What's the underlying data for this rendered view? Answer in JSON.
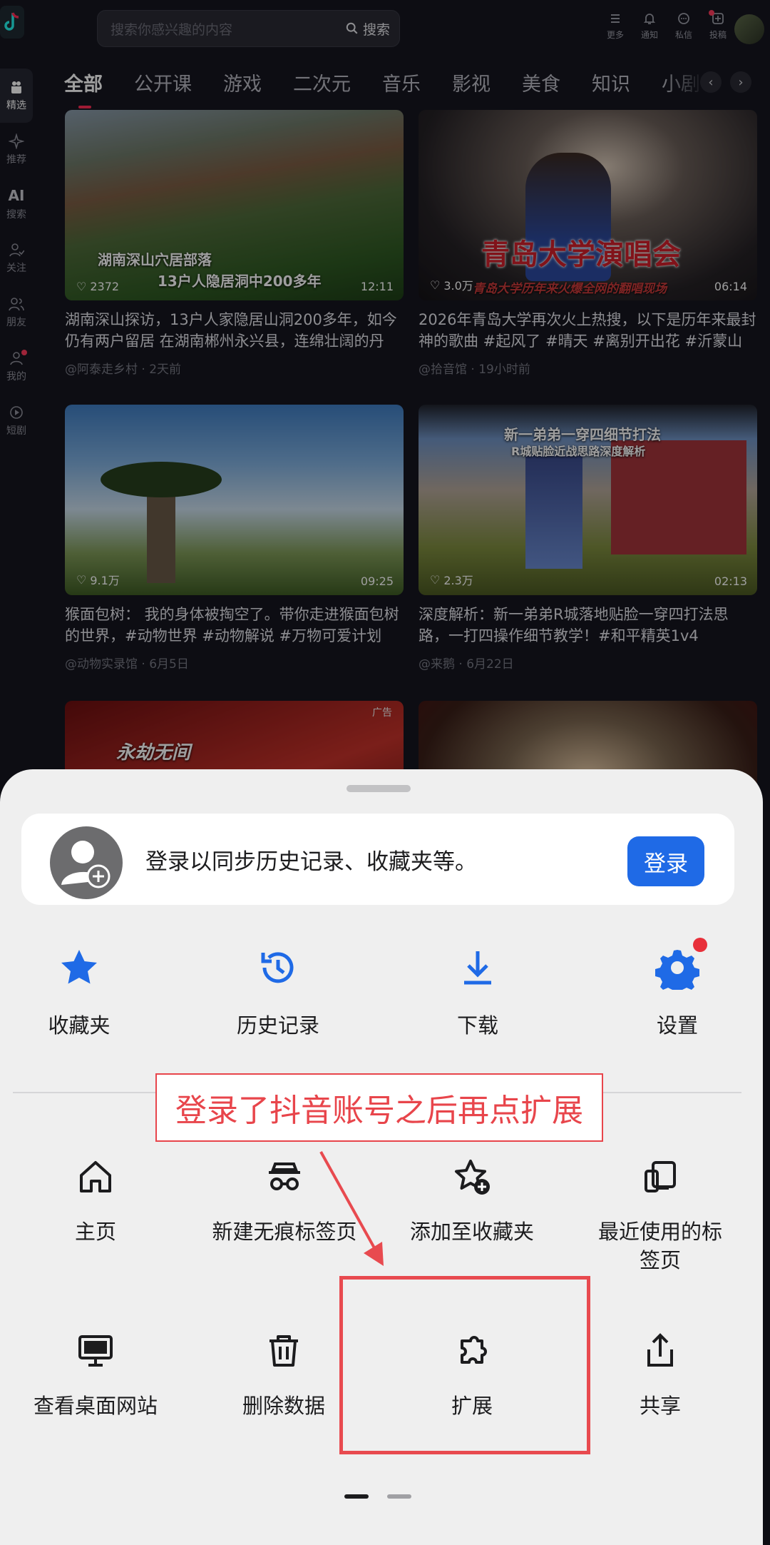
{
  "search": {
    "placeholder": "搜索你感兴趣的内容",
    "button": "搜索"
  },
  "top_icons": [
    {
      "label": "更多",
      "icon": "menu-icon"
    },
    {
      "label": "通知",
      "icon": "bell-icon"
    },
    {
      "label": "私信",
      "icon": "message-icon"
    },
    {
      "label": "投稿",
      "icon": "upload-icon"
    }
  ],
  "rail": [
    {
      "label": "精选",
      "icon": "featured-icon"
    },
    {
      "label": "推荐",
      "icon": "sparkle-icon"
    },
    {
      "label": "AI",
      "label2": "搜索",
      "icon": "ai-search-icon"
    },
    {
      "label": "关注",
      "icon": "follow-icon"
    },
    {
      "label": "朋友",
      "icon": "friends-icon"
    },
    {
      "label": "我的",
      "icon": "profile-icon"
    },
    {
      "label": "短剧",
      "icon": "short-drama-icon"
    }
  ],
  "tabs": [
    "全部",
    "公开课",
    "游戏",
    "二次元",
    "音乐",
    "影视",
    "美食",
    "知识",
    "小剧"
  ],
  "tab_arrows": {
    "prev": "‹",
    "next": "›"
  },
  "cards": [
    {
      "caption1": "湖南深山穴居部落",
      "caption2": "13户人隐居洞中200多年",
      "likes": "2372",
      "duration": "12:11",
      "title": "湖南深山探访，13户人家隐居山洞200多年，如今仍有两户留居 在湖南郴州永兴县，连绵壮阔的丹霞...",
      "meta": "@阿泰走乡村 · 2天前"
    },
    {
      "caption1": "青岛大学演唱会",
      "caption2": "青岛大学历年来火爆全网的翻唱现场",
      "likes": "3.0万",
      "duration": "06:14",
      "title": "2026年青岛大学再次火上热搜，以下是历年来最封神的歌曲 #起风了 #晴天 #离别开出花 #沂蒙山小调",
      "meta": "@拾音馆 · 19小时前"
    },
    {
      "caption1": "",
      "caption2": "",
      "likes": "9.1万",
      "duration": "09:25",
      "title": "猴面包树： 我的身体被掏空了。带你走进猴面包树的世界，#动物世界 #动物解说 #万物可爱计划 #...",
      "meta": "@动物实录馆 · 6月5日"
    },
    {
      "caption1": "新一弟弟一穿四细节打法",
      "caption2": "R城贴脸近战思路深度解析",
      "likes": "2.3万",
      "duration": "02:13",
      "title": "深度解析：新一弟弟R城落地贴脸一穿四打法思路，一打四操作细节教学！#和平精英1v4",
      "meta": "@来鹅 · 6月22日"
    }
  ],
  "ad_tag": "广告",
  "ad_caption": "永劫无间",
  "sheet": {
    "login_message": "登录以同步历史记录、收藏夹等。",
    "login_button": "登录",
    "quick": [
      {
        "label": "收藏夹",
        "icon": "star-icon"
      },
      {
        "label": "历史记录",
        "icon": "history-icon"
      },
      {
        "label": "下载",
        "icon": "download-icon"
      },
      {
        "label": "设置",
        "icon": "gear-icon"
      }
    ],
    "grid": [
      {
        "label": "主页",
        "icon": "home-icon"
      },
      {
        "label": "新建无痕标签页",
        "icon": "incognito-icon"
      },
      {
        "label": "添加至收藏夹",
        "icon": "add-favorite-icon"
      },
      {
        "label": "最近使用的标签页",
        "icon": "recent-tabs-icon"
      },
      {
        "label": "查看桌面网站",
        "icon": "desktop-icon"
      },
      {
        "label": "删除数据",
        "icon": "trash-icon"
      },
      {
        "label": "扩展",
        "icon": "puzzle-icon"
      },
      {
        "label": "共享",
        "icon": "share-icon"
      }
    ]
  },
  "annotation": "登录了抖音账号之后再点扩展",
  "colors": {
    "accent_blue": "#1f6ae6",
    "annotation_red": "#e8454b",
    "badge_red": "#ff3b5c",
    "tab_underline": "#ff2d55"
  }
}
